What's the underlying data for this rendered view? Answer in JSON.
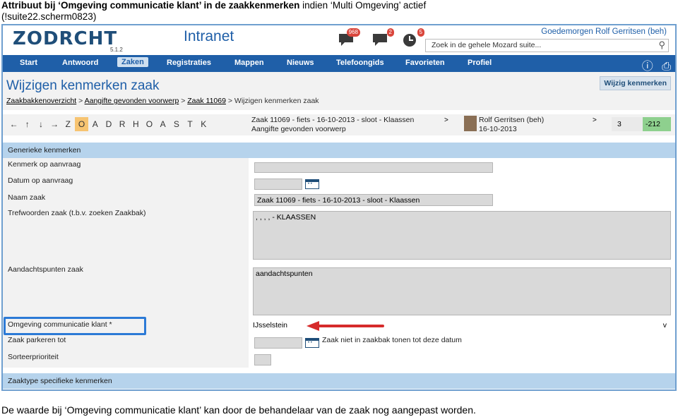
{
  "doc": {
    "title_bold": "Attribuut bij ‘Omgeving communicatie klant’ in de zaakkenmerken",
    "title_rest": " indien  ‘Multi Omgeving’ actief",
    "title_line2": "(!suite22.scherm0823)",
    "caption": "De waarde bij ‘Omgeving communicatie klant’ kan door de behandelaar van de zaak nog aangepast worden."
  },
  "header": {
    "logo_text": "ZODRCHT",
    "logo_version": "5.1.2",
    "app_title": "Intranet",
    "badges": [
      "968",
      "2",
      "5"
    ],
    "user_greeting": "Goedemorgen Rolf Gerritsen (beh)",
    "search_placeholder": "Zoek in de gehele Mozard suite..."
  },
  "nav": {
    "items": [
      "Start",
      "Antwoord",
      "Zaken",
      "Registraties",
      "Mappen",
      "Nieuws",
      "Telefoongids",
      "Favorieten",
      "Profiel"
    ],
    "active": "Zaken"
  },
  "page": {
    "title": "Wijzigen kenmerken zaak",
    "breadcrumb": [
      "Zaakbakkenoverzicht",
      "Aangifte gevonden voorwerp",
      "Zaak 11069",
      "Wijzigen kenmerken zaak"
    ],
    "action_button": "Wijzig kenmerken"
  },
  "toolbar": {
    "letters": [
      "←",
      "↑",
      "↓",
      "→",
      "Z",
      "O",
      "A",
      "D",
      "R",
      "H",
      "O",
      "A",
      "S",
      "T",
      "K"
    ],
    "selected_letter": "O",
    "zaak_line1": "Zaak 11069 - fiets - 16-10-2013 - sloot - Klaassen",
    "zaak_line2": "Aangifte gevonden voorwerp",
    "arrow": ">",
    "person_name": "Rolf Gerritsen (beh)",
    "person_date": "16-10-2013",
    "num_left": "3",
    "num_right": "-212"
  },
  "sections": {
    "generic": "Generieke kenmerken",
    "specific": "Zaaktype specifieke kenmerken"
  },
  "fields": {
    "kenmerk_label": "Kenmerk op aanvraag",
    "kenmerk_value": "",
    "datum_label": "Datum op aanvraag",
    "naam_label": "Naam zaak",
    "naam_value": "Zaak 11069 - fiets - 16-10-2013 - sloot - Klaassen",
    "trefwoorden_label": "Trefwoorden zaak (t.b.v. zoeken Zaakbak)",
    "trefwoorden_value": ", , , , - KLAASSEN",
    "aandacht_label": "Aandachtspunten zaak",
    "aandacht_value": "aandachtspunten",
    "omgeving_label": "Omgeving communicatie klant *",
    "omgeving_value": "IJsselstein",
    "omgeving_arrow": "v",
    "parkeren_label": "Zaak parkeren tot",
    "parkeren_note": "Zaak niet in zaakbak tonen tot deze datum",
    "sorteer_label": "Sorteerprioriteit"
  },
  "colors": {
    "brand_blue": "#1f5fa8",
    "section_bg": "#b6d3ec",
    "highlight_box": "#2c7ad6",
    "annotation_arrow": "#d62b2b",
    "positive_num_bg": "#8ed08e"
  }
}
